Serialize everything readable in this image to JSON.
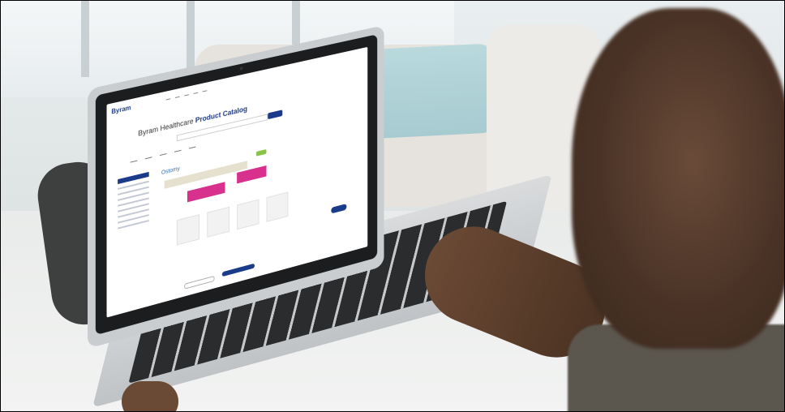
{
  "photo": {
    "subject": "laptop-browsing-scene"
  },
  "site": {
    "logo": "Byram",
    "heading_prefix": "Byram Healthcare",
    "heading_highlight": "Product Catalog",
    "section_title": "Ostomy",
    "brand_color": "#1a3a8a",
    "accent_color": "#d8308d",
    "green_color": "#8bc34a"
  }
}
